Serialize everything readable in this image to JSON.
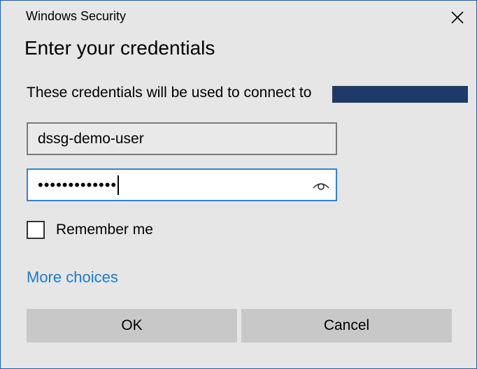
{
  "window": {
    "title": "Windows Security"
  },
  "dialog": {
    "heading": "Enter your credentials",
    "subtext": "These credentials will be used to connect to"
  },
  "form": {
    "username_value": "dssg-demo-user",
    "password_masked": "•••••••••••••"
  },
  "remember": {
    "label": "Remember me",
    "checked": false
  },
  "more_choices_label": "More choices",
  "buttons": {
    "ok": "OK",
    "cancel": "Cancel"
  },
  "icons": {
    "close": "close-icon",
    "reveal": "eye-icon"
  },
  "colors": {
    "accent": "#2f84d1",
    "link": "#1a7ccb",
    "redaction": "#1e3a68"
  }
}
